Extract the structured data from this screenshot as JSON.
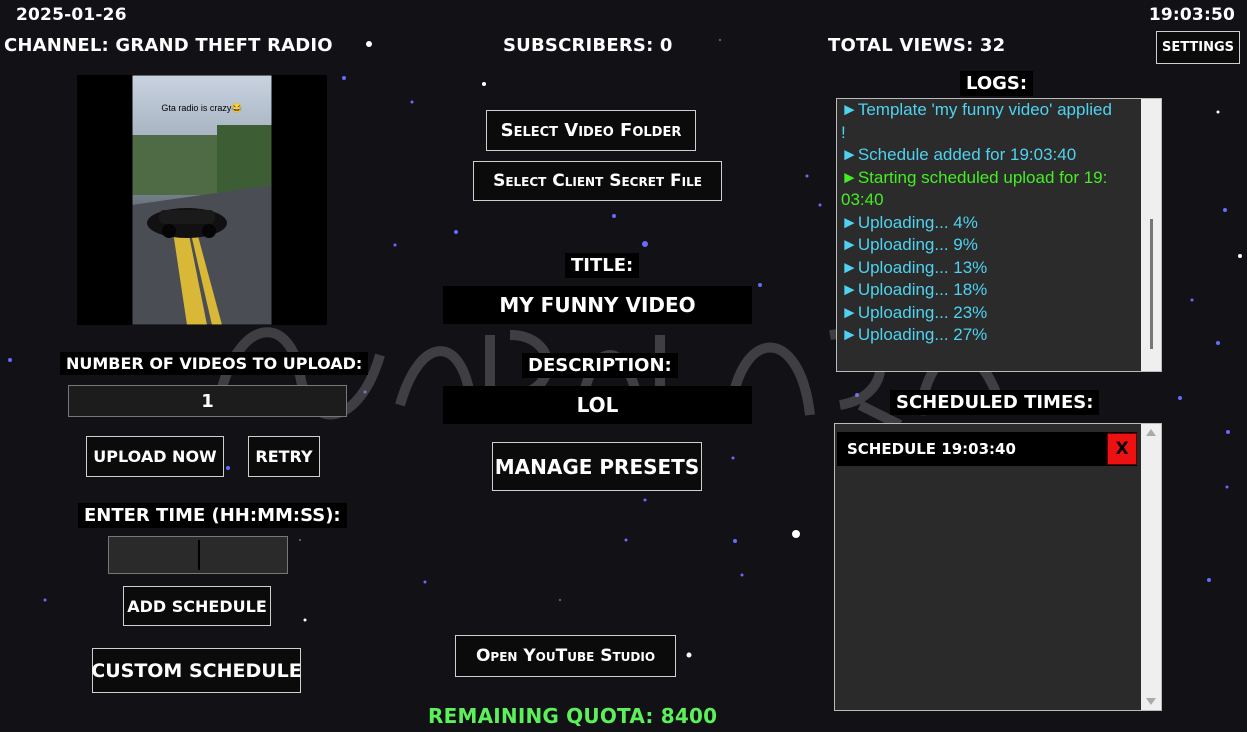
{
  "header": {
    "date": "2025-01-26",
    "time": "19:03:50",
    "channel": "CHANNEL: GRAND THEFT RADIO",
    "subscribers": "SUBSCRIBERS: 0",
    "total_views": "TOTAL VIEWS: 32",
    "settings_label": "SETTINGS"
  },
  "preview": {
    "caption": "Gta radio is crazy😂"
  },
  "left": {
    "num_videos_label": "NUMBER OF VIDEOS TO UPLOAD:",
    "num_videos_value": "1",
    "upload_now_label": "UPLOAD NOW",
    "retry_label": "RETRY",
    "enter_time_label": "ENTER TIME (HH:MM:SS):",
    "time_value": "",
    "add_schedule_label": "ADD SCHEDULE",
    "custom_schedule_label": "CUSTOM SCHEDULE"
  },
  "center": {
    "select_folder_label": "Select Video Folder",
    "select_secret_label": "Select Client Secret File",
    "title_label": "TITLE:",
    "title_value": "MY FUNNY VIDEO",
    "description_label": "DESCRIPTION:",
    "description_value": "LOL",
    "manage_presets_label": "MANAGE PRESETS",
    "open_studio_label": "Open YouTube Studio",
    "quota": "REMAINING QUOTA: 8400"
  },
  "logs": {
    "title": "LOGS:",
    "lines": [
      {
        "text": "►Template 'my funny video' applied",
        "color": "#4fd2f0"
      },
      {
        "text": "!",
        "color": "#4fd2f0"
      },
      {
        "text": "►Schedule added for 19:03:40",
        "color": "#4fd2f0"
      },
      {
        "text": "►Starting scheduled upload for 19:",
        "color": "#44ee22"
      },
      {
        "text": "03:40",
        "color": "#44ee22"
      },
      {
        "text": "►Uploading... 4%",
        "color": "#4fd2f0"
      },
      {
        "text": "►Uploading... 9%",
        "color": "#4fd2f0"
      },
      {
        "text": "►Uploading... 13%",
        "color": "#4fd2f0"
      },
      {
        "text": "►Uploading... 18%",
        "color": "#4fd2f0"
      },
      {
        "text": "►Uploading... 23%",
        "color": "#4fd2f0"
      },
      {
        "text": "►Uploading... 27%",
        "color": "#4fd2f0"
      }
    ]
  },
  "schedule": {
    "title": "SCHEDULED TIMES:",
    "items": [
      {
        "label": "SCHEDULE 19:03:40",
        "delete_label": "X"
      }
    ]
  },
  "colors": {
    "quota": "#5cf05a",
    "log_info": "#4fd2f0",
    "log_success": "#44ee22",
    "delete": "#ee1111"
  }
}
